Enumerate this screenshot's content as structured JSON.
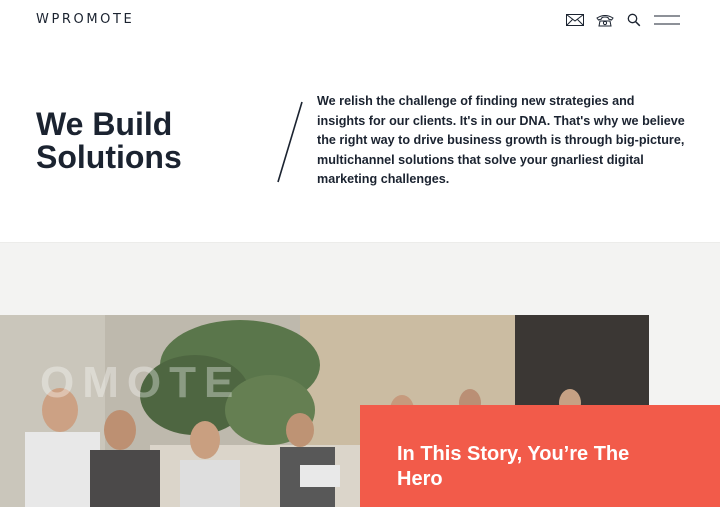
{
  "header": {
    "logo_text": "WPROMOTE",
    "icons": [
      "mail-icon",
      "phone-icon",
      "search-icon",
      "menu-icon"
    ]
  },
  "intro": {
    "headline_line1": "We Build",
    "headline_line2": "Solutions",
    "body": "We relish the challenge of finding new strategies and insights for our clients. It's in our DNA. That's why we believe the right way to drive business growth is through big-picture, multichannel solutions that solve your gnarliest digital marketing challenges."
  },
  "story": {
    "title": "In This Story, You’re The Hero"
  },
  "photo": {
    "wall_lettering": "OMOTE"
  },
  "colors": {
    "text": "#1b2330",
    "accent": "#f25b4a",
    "band": "#f3f3f2"
  }
}
